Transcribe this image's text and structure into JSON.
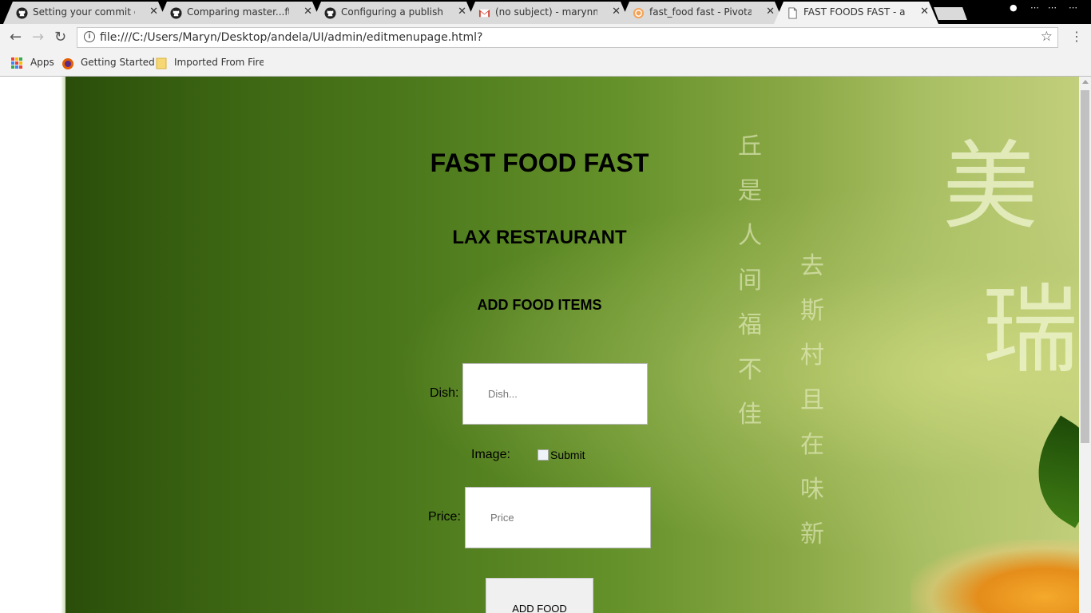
{
  "browser": {
    "tabs": [
      {
        "title": "Setting your commit ema",
        "icon": "github-icon",
        "active": false
      },
      {
        "title": "Comparing master...ft-ma",
        "icon": "github-icon",
        "active": false
      },
      {
        "title": "Configuring a publishing",
        "icon": "github-icon",
        "active": false
      },
      {
        "title": "(no subject) - marynmwir",
        "icon": "gmail-icon",
        "active": false
      },
      {
        "title": "fast_food fast - Pivotal Tr",
        "icon": "pivotal-icon",
        "active": false
      },
      {
        "title": "FAST FOODS FAST - adm",
        "icon": "page-icon",
        "active": true
      }
    ],
    "url": "file:///C:/Users/Maryn/Desktop/andela/UI/admin/editmenupage.html?",
    "bookmarks": [
      {
        "label": "Apps",
        "icon": "apps-grid-icon"
      },
      {
        "label": "Getting Started",
        "icon": "firefox-icon"
      },
      {
        "label": "Imported From Firefo",
        "icon": "folder-icon"
      }
    ]
  },
  "page": {
    "title": "FAST FOOD FAST",
    "restaurant": "LAX RESTAURANT",
    "section_heading": "ADD FOOD ITEMS",
    "form": {
      "dish_label": "Dish:",
      "dish_placeholder": "Dish...",
      "image_label": "Image:",
      "image_button_alt": "Submit",
      "price_label": "Price:",
      "price_placeholder": "Price",
      "submit_label": "ADD FOOD"
    }
  }
}
